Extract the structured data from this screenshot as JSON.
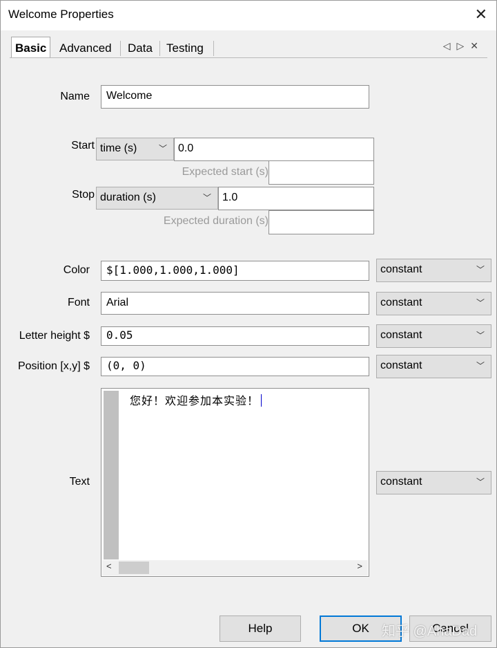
{
  "window": {
    "title": "Welcome Properties"
  },
  "tabs": [
    "Basic",
    "Advanced",
    "Data",
    "Testing"
  ],
  "tab_nav": {
    "prev": "◁",
    "next": "▷",
    "close": "✕"
  },
  "form": {
    "name": {
      "label": "Name",
      "value": "Welcome"
    },
    "start": {
      "label": "Start",
      "type": "time (s)",
      "value": "0.0",
      "expected_label": "Expected start (s)",
      "expected_value": ""
    },
    "stop": {
      "label": "Stop",
      "type": "duration (s)",
      "value": "1.0",
      "expected_label": "Expected duration (s)",
      "expected_value": ""
    },
    "color": {
      "label": "Color",
      "value": "$[1.000,1.000,1.000]",
      "mode": "constant"
    },
    "font": {
      "label": "Font",
      "value": "Arial",
      "mode": "constant"
    },
    "letter_height": {
      "label": "Letter height $",
      "value": "0.05",
      "mode": "constant"
    },
    "position": {
      "label": "Position [x,y] $",
      "value": "(0, 0)",
      "mode": "constant"
    },
    "text": {
      "label": "Text",
      "value": "您好！欢迎参加本实验！",
      "mode": "constant"
    }
  },
  "buttons": {
    "help": "Help",
    "ok": "OK",
    "cancel": "Cancel"
  },
  "watermark": "知乎 @AhaDad"
}
